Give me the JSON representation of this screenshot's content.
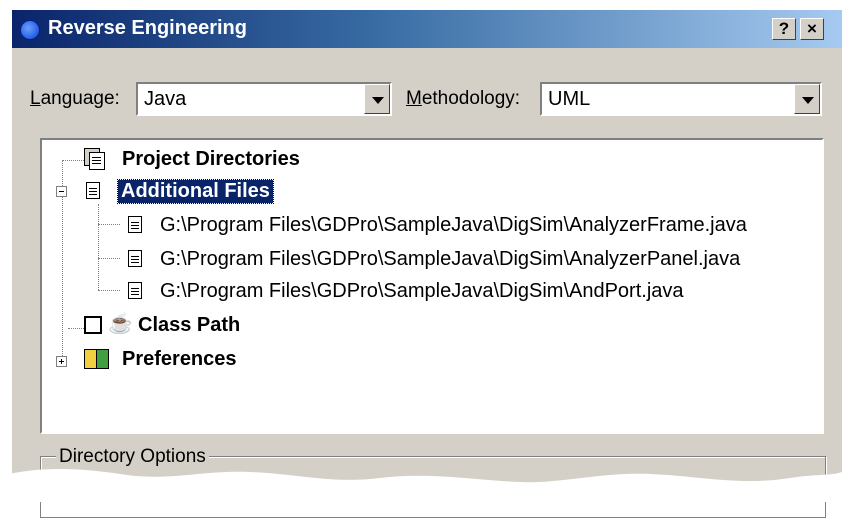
{
  "window": {
    "title": "Reverse Engineering",
    "help_button": "?",
    "close_button": "×"
  },
  "language": {
    "label_prefix": "",
    "label_mnemonic": "L",
    "label_rest": "anguage:",
    "value": "Java"
  },
  "methodology": {
    "label_mnemonic": "M",
    "label_rest": "ethodology:",
    "value": "UML"
  },
  "tree": {
    "project_directories": "Project Directories",
    "additional_files": "Additional Files",
    "files": [
      "G:\\Program Files\\GDPro\\SampleJava\\DigSim\\AnalyzerFrame.java",
      "G:\\Program Files\\GDPro\\SampleJava\\DigSim\\AnalyzerPanel.java",
      "G:\\Program Files\\GDPro\\SampleJava\\DigSim\\AndPort.java"
    ],
    "class_path": "Class Path",
    "preferences": "Preferences"
  },
  "directory_options": {
    "label": "Directory Options"
  },
  "colors": {
    "titlebar_start": "#0a246a",
    "titlebar_end": "#a6caf0",
    "face": "#d4d0c8",
    "selection": "#0a246a"
  }
}
